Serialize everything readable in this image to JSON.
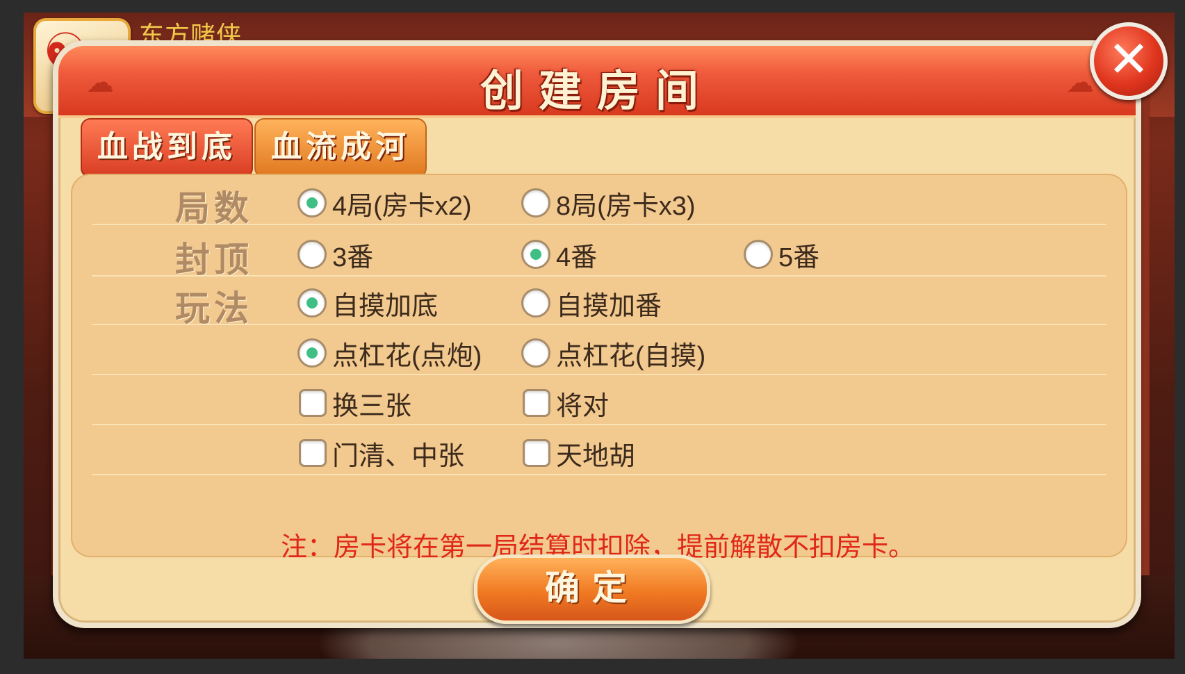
{
  "player": {
    "name": "东方赌侠",
    "avatar_icon": "dragon-icon"
  },
  "dialog": {
    "title": "创建房间",
    "close_icon": "close-icon"
  },
  "tabs": [
    {
      "label": "血战到底",
      "active": true
    },
    {
      "label": "血流成河",
      "active": false
    }
  ],
  "rows": {
    "rounds": {
      "label": "局数",
      "options": [
        {
          "label": "4局(房卡x2)",
          "selected": true
        },
        {
          "label": "8局(房卡x3)",
          "selected": false
        }
      ]
    },
    "cap": {
      "label": "封顶",
      "options": [
        {
          "label": "3番",
          "selected": false
        },
        {
          "label": "4番",
          "selected": true
        },
        {
          "label": "5番",
          "selected": false
        }
      ]
    },
    "play": {
      "label": "玩法",
      "self_draw": [
        {
          "label": "自摸加底",
          "selected": true
        },
        {
          "label": "自摸加番",
          "selected": false
        }
      ],
      "kong_flower": [
        {
          "label": "点杠花(点炮)",
          "selected": true
        },
        {
          "label": "点杠花(自摸)",
          "selected": false
        }
      ],
      "extras": [
        {
          "label": "换三张",
          "checked": false
        },
        {
          "label": "将对",
          "checked": false
        },
        {
          "label": "门清、中张",
          "checked": false
        },
        {
          "label": "天地胡",
          "checked": false
        }
      ]
    }
  },
  "note": "注：房卡将在第一局结算时扣除，提前解散不扣房卡。",
  "confirm_label": "确定",
  "colors": {
    "header_red": "#d8391f",
    "panel_bg": "#f2c98f",
    "radio_selected": "#3fbf84",
    "note_red": "#e02818",
    "confirm_orange": "#f07a22"
  }
}
